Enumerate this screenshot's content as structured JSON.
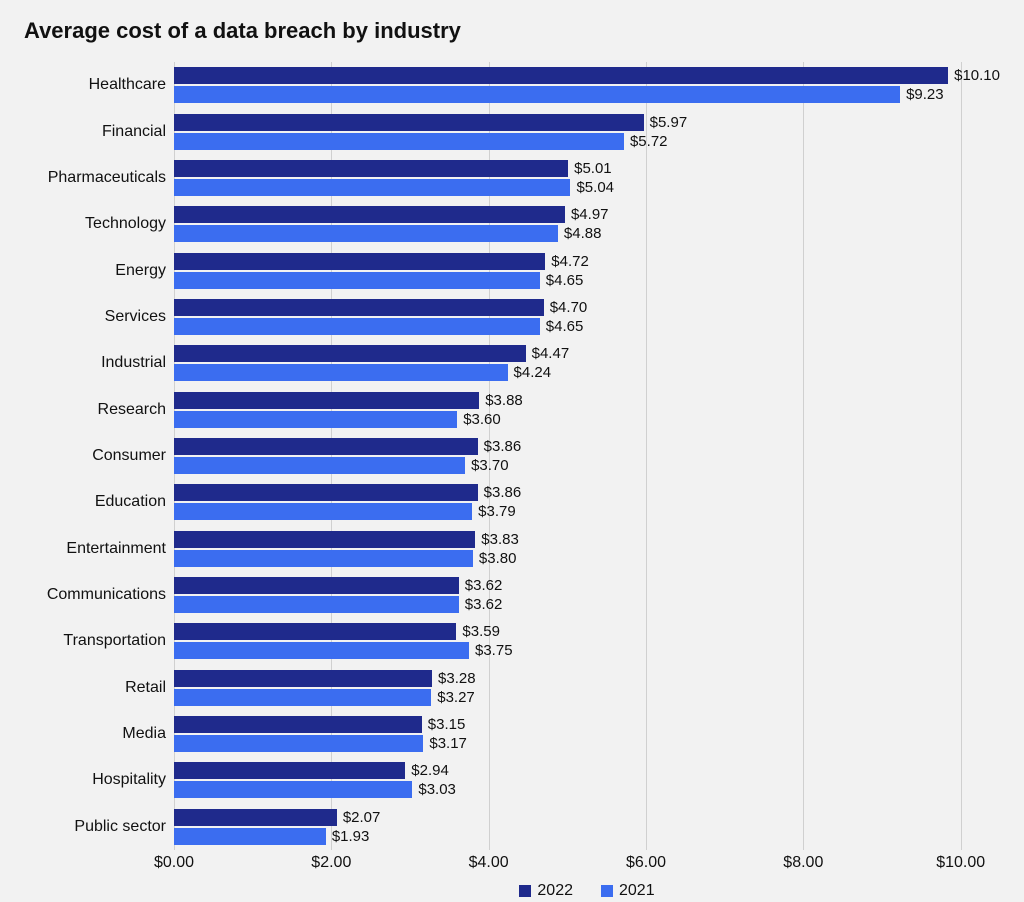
{
  "chart_data": {
    "type": "bar",
    "orientation": "horizontal",
    "title": "Average cost of a data breach by industry",
    "xlabel": "",
    "ylabel": "",
    "x_ticks": [
      "$0.00",
      "$2.00",
      "$4.00",
      "$6.00",
      "$8.00",
      "$10.00"
    ],
    "x_range": [
      0,
      10.5
    ],
    "categories": [
      "Healthcare",
      "Financial",
      "Pharmaceuticals",
      "Technology",
      "Energy",
      "Services",
      "Industrial",
      "Research",
      "Consumer",
      "Education",
      "Entertainment",
      "Communications",
      "Transportation",
      "Retail",
      "Media",
      "Hospitality",
      "Public sector"
    ],
    "series": [
      {
        "name": "2022",
        "color": "#1f2a8c",
        "values": [
          10.1,
          5.97,
          5.01,
          4.97,
          4.72,
          4.7,
          4.47,
          3.88,
          3.86,
          3.86,
          3.83,
          3.62,
          3.59,
          3.28,
          3.15,
          2.94,
          2.07
        ]
      },
      {
        "name": "2021",
        "color": "#3b6df0",
        "values": [
          9.23,
          5.72,
          5.04,
          4.88,
          4.65,
          4.65,
          4.24,
          3.6,
          3.7,
          3.79,
          3.8,
          3.62,
          3.75,
          3.27,
          3.17,
          3.03,
          1.93
        ]
      }
    ],
    "value_prefix": "$",
    "value_format": "0.00",
    "legend_position": "bottom"
  }
}
